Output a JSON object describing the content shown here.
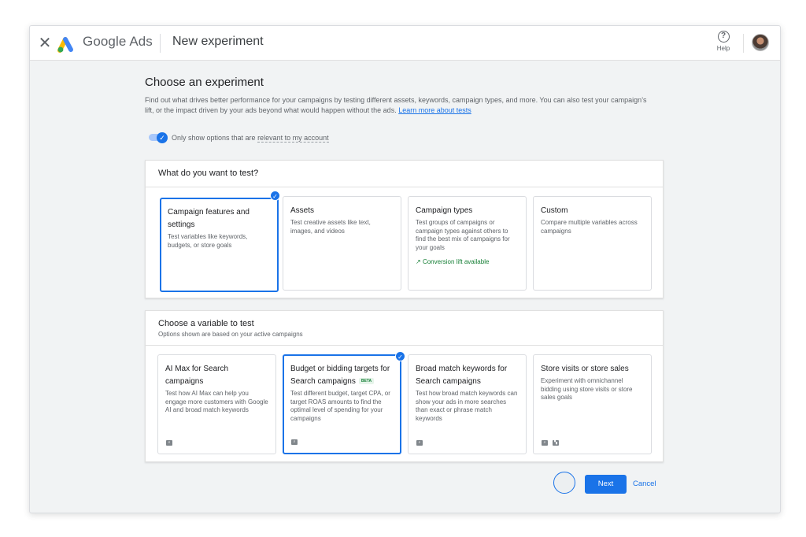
{
  "header": {
    "brand_google": "Google",
    "brand_ads": "Ads",
    "page_title": "New experiment",
    "help_label": "Help",
    "close_icon": "close-icon",
    "help_icon": "help-circle-icon"
  },
  "intro": {
    "heading": "Choose an experiment",
    "description": "Find out what drives better performance for your campaigns by testing different assets, keywords, campaign types, and more. You can also test your campaign’s lift, or the impact driven by your ads beyond what would happen without the ads.",
    "learn_more": "Learn more about tests",
    "toggle_label_prefix": "Only show options that are ",
    "toggle_label_link": "relevant to my account",
    "toggle_on": true
  },
  "test_panel": {
    "title": "What do you want to test?",
    "cards": [
      {
        "title": "Campaign features and settings",
        "desc": "Test variables like keywords, budgets, or store goals",
        "selected": true
      },
      {
        "title": "Assets",
        "desc": "Test creative assets like text, images, and videos",
        "selected": false
      },
      {
        "title": "Campaign types",
        "desc": "Test groups of campaigns or campaign types against others to find the best mix of campaigns for your goals",
        "extra": "Conversion lift available",
        "selected": false
      },
      {
        "title": "Custom",
        "desc": "Compare multiple variables across campaigns",
        "selected": false
      }
    ]
  },
  "variable_panel": {
    "title": "Choose a variable to test",
    "subtitle": "Options shown are based on your active campaigns",
    "cards": [
      {
        "title": "AI Max for Search campaigns",
        "desc": "Test how AI Max can help you engage more customers with Google AI and broad match keywords",
        "selected": false
      },
      {
        "title": "Budget or bidding targets for Search campaigns",
        "badge": "BETA",
        "desc": "Test different budget, target CPA, or target ROAS amounts to find the optimal level of spending for your campaigns",
        "selected": true
      },
      {
        "title": "Broad match keywords for Search campaigns",
        "desc": "Test how broad match keywords can show your ads in more searches than exact or phrase match keywords",
        "selected": false
      },
      {
        "title": "Store visits or store sales",
        "desc": "Experiment with omnichannel bidding using store visits or store sales goals",
        "selected": false
      }
    ]
  },
  "footer": {
    "next_label": "Next",
    "cancel_label": "Cancel"
  },
  "colors": {
    "accent": "#1a73e8",
    "success": "#188038"
  }
}
